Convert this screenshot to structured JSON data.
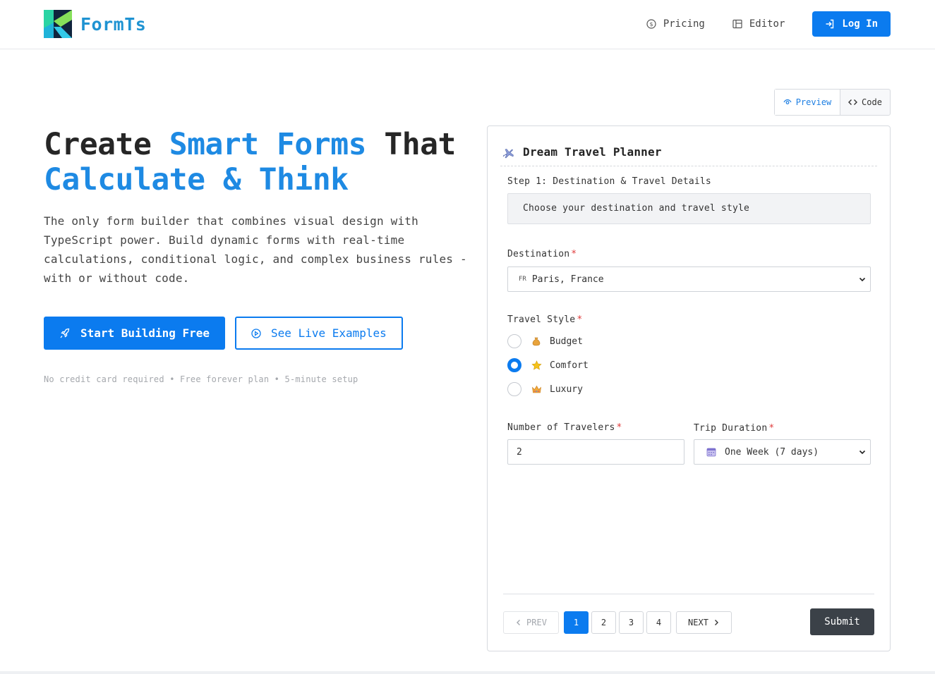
{
  "nav": {
    "brand": "FormTs",
    "pricing": "Pricing",
    "editor": "Editor",
    "login": "Log In"
  },
  "hero": {
    "title_1": "Create ",
    "title_2": "Smart Forms",
    "title_3": " That",
    "title_4": "Calculate & Think",
    "description": "The only form builder that combines visual design with TypeScript power. Build dynamic forms with real-time calculations, conditional logic, and complex business rules - with or without code.",
    "cta_primary": "Start Building Free",
    "cta_secondary": "See Live Examples",
    "fine_print": "No credit card required • Free forever plan • 5-minute setup"
  },
  "view_toggle": {
    "preview": "Preview",
    "code": "Code"
  },
  "form": {
    "title": "Dream Travel Planner",
    "step_label": "Step 1: Destination & Travel Details",
    "step_desc": "Choose your destination and travel style",
    "destination_label": "Destination",
    "destination_flag": "FR",
    "destination_value": "Paris, France",
    "style_label": "Travel Style",
    "style_options": [
      "Budget",
      "Comfort",
      "Luxury"
    ],
    "style_selected": "Comfort",
    "travelers_label": "Number of Travelers",
    "travelers_value": "2",
    "duration_label": "Trip Duration",
    "duration_value": "One Week (7 days)",
    "required_mark": "*"
  },
  "pager": {
    "prev": "PREV",
    "pages": [
      "1",
      "2",
      "3",
      "4"
    ],
    "active_page": "1",
    "next": "NEXT",
    "submit": "Submit"
  },
  "colors": {
    "primary": "#0b7bef",
    "brand": "#1f93d2",
    "dark_button": "#3b4148",
    "required": "#e03b3b"
  }
}
